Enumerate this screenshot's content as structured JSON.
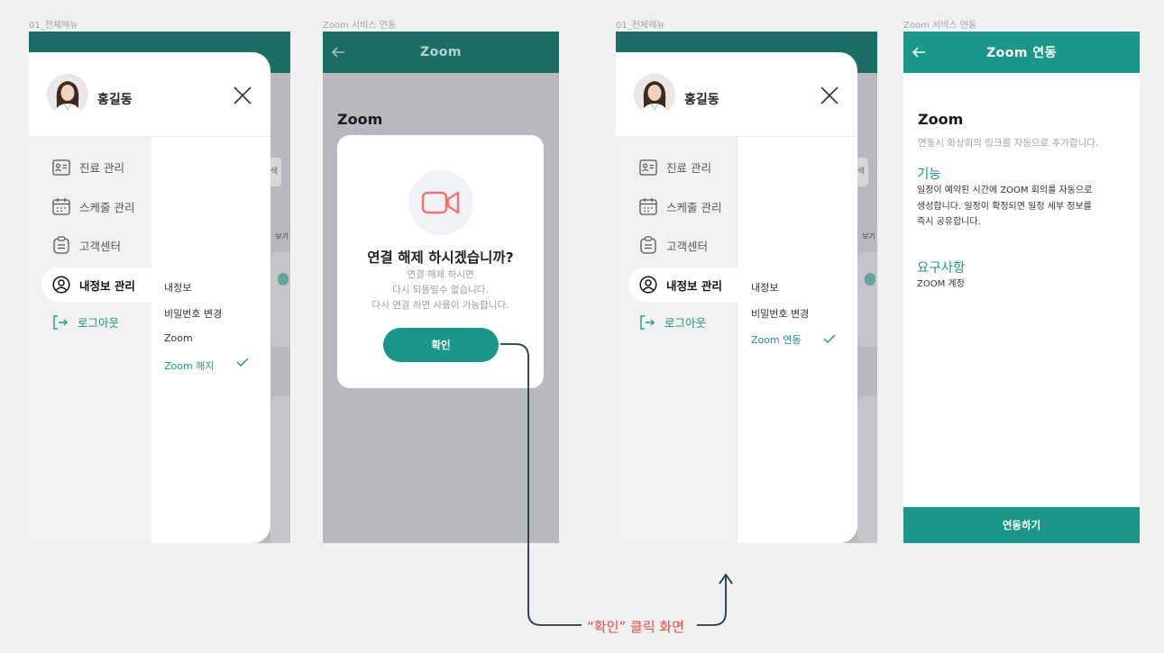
{
  "captions": {
    "s1": "01_전체메뉴",
    "s2": "Zoom 서비스 연동",
    "s3": "01_전체메뉴",
    "s4": "Zoom 서비스 연동"
  },
  "colors": {
    "teal": "#1b978a",
    "dark_teal": "#1b6e66",
    "annotation": "#e6493f"
  },
  "menu": {
    "user_name": "홍길동",
    "nav": [
      {
        "label": "진료 관리",
        "icon": "id-card-icon"
      },
      {
        "label": "스케줄 관리",
        "icon": "calendar-icon"
      },
      {
        "label": "고객센터",
        "icon": "clipboard-icon"
      },
      {
        "label": "내정보 관리",
        "icon": "user-circle-icon"
      },
      {
        "label": "로그아웃",
        "icon": "logout-icon"
      }
    ],
    "sub_items_1": [
      "내정보",
      "비밀번호 변경",
      "Zoom",
      "Zoom 해지"
    ],
    "sub_items_2": [
      "내정보",
      "비밀번호 변경",
      "Zoom 연동"
    ]
  },
  "bg_peek": {
    "btn_text": "색",
    "label_text": "보기"
  },
  "dialog_screen": {
    "title": "Zoom",
    "heading": "Zoom",
    "peek_text": "",
    "dialog": {
      "title": "연결 해제 하시겠습니까?",
      "desc": [
        "연결 해제 하시면",
        "다시 되돌릴수 없습니다.",
        "다시 연결 하면 사용이 가능합니다."
      ],
      "button": "확인"
    }
  },
  "detail_screen": {
    "title": "Zoom 연동",
    "heading": "Zoom",
    "subtitle": "연동시 화상회의 링크를 자동으로 추가합니다.",
    "feature_title": "기능",
    "feature_lines": [
      "일정이 예약된 시간에 ZOOM 회의를 자동으로",
      "생성합니다. 일정이 확정되면 일정 세부 정보를",
      "즉시 공유합니다."
    ],
    "req_title": "요구사항",
    "req_body": "ZOOM 계정",
    "button": "연동하기"
  },
  "annotation": "“확인” 클릭 화면"
}
